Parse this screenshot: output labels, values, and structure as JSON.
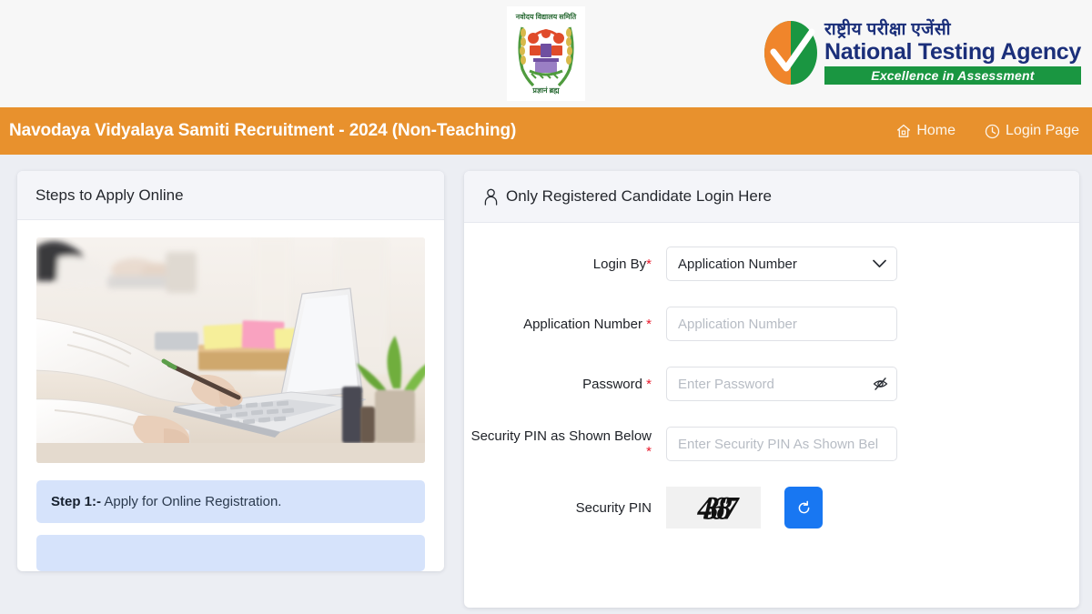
{
  "header": {
    "nvs_emblem_alt": "Navodaya Vidyalaya Samiti Emblem",
    "nta": {
      "hindi": "राष्ट्रीय परीक्षा एजेंसी",
      "english": "National Testing Agency",
      "tagline": "Excellence in Assessment"
    }
  },
  "navbar": {
    "title": "Navodaya Vidyalaya Samiti Recruitment - 2024 (Non-Teaching)",
    "links": [
      {
        "label": "Home",
        "icon": "home-icon"
      },
      {
        "label": "Login Page",
        "icon": "clock-icon"
      }
    ],
    "background": "#e8912d"
  },
  "left_panel": {
    "title": "Steps to Apply Online",
    "image_alt": "Person typing on a laptop at a desk with sticky notes",
    "steps": [
      {
        "label": "Step 1:-",
        "text": " Apply for Online Registration."
      }
    ]
  },
  "login_panel": {
    "title": "Only Registered Candidate Login Here",
    "icon": "person-icon",
    "fields": {
      "login_by": {
        "label": "Login By",
        "required": "*",
        "value": "Application Number",
        "options": [
          "Application Number"
        ]
      },
      "application_number": {
        "label": "Application Number",
        "required": "*",
        "value": "",
        "placeholder": "Application Number"
      },
      "password": {
        "label": "Password",
        "required": "*",
        "value": "",
        "placeholder": "Enter Password",
        "toggle_icon": "eye-slash-icon"
      },
      "security_pin_input": {
        "label": "Security PIN as Shown Below",
        "required": "*",
        "value": "",
        "placeholder": "Enter Security PIN As Shown Bel"
      },
      "security_pin_captcha": {
        "label": "Security PIN",
        "captcha_value": "43687",
        "refresh_icon": "refresh-icon",
        "refresh_color": "#1877f2"
      }
    }
  }
}
